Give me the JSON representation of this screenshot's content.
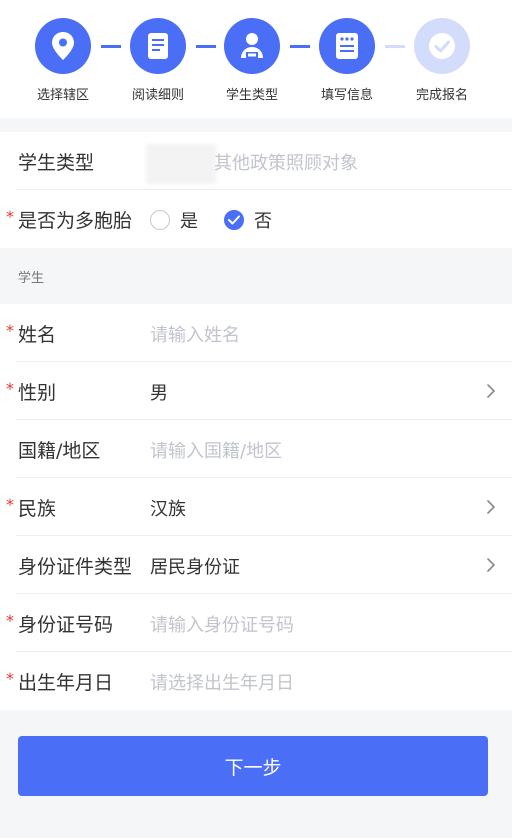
{
  "steps": [
    {
      "label": "选择辖区",
      "icon": "location-pin-icon",
      "state": "done"
    },
    {
      "label": "阅读细则",
      "icon": "document-icon",
      "state": "done"
    },
    {
      "label": "学生类型",
      "icon": "student-icon",
      "state": "done"
    },
    {
      "label": "填写信息",
      "icon": "form-icon",
      "state": "current"
    },
    {
      "label": "完成报名",
      "icon": "check-icon",
      "state": "todo"
    }
  ],
  "student_type": {
    "label": "学生类型",
    "value": "其他政策照顾对象"
  },
  "multiple_birth": {
    "label": "是否为多胞胎",
    "required": true,
    "options": [
      "是",
      "否"
    ],
    "selected": "否"
  },
  "section_title": "学生",
  "fields": [
    {
      "label": "姓名",
      "required": true,
      "placeholder": "请输入姓名",
      "value": "",
      "dropdown": false
    },
    {
      "label": "性别",
      "required": true,
      "placeholder": "",
      "value": "男",
      "dropdown": true
    },
    {
      "label": "国籍/地区",
      "required": false,
      "placeholder": "请输入国籍/地区",
      "value": "",
      "dropdown": false
    },
    {
      "label": "民族",
      "required": true,
      "placeholder": "",
      "value": "汉族",
      "dropdown": true
    },
    {
      "label": "身份证件类型",
      "required": false,
      "placeholder": "",
      "value": "居民身份证",
      "dropdown": true
    },
    {
      "label": "身份证号码",
      "required": true,
      "placeholder": "请输入身份证号码",
      "value": "",
      "dropdown": false
    },
    {
      "label": "出生年月日",
      "required": true,
      "placeholder": "请选择出生年月日",
      "value": "",
      "dropdown": false
    }
  ],
  "required_mark": "*",
  "next_button": "下一步",
  "colors": {
    "primary": "#4a6ef5",
    "inactive": "#d4dcfb",
    "required": "#e53935",
    "placeholder": "#c0c4cc"
  }
}
